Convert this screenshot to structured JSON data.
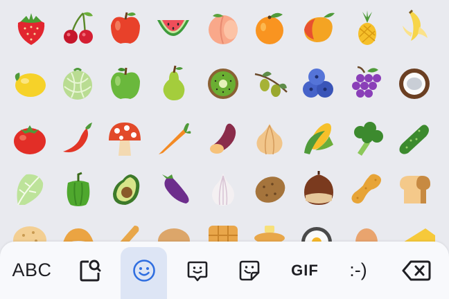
{
  "emoji_grid": {
    "rows": [
      [
        "strawberry-icon",
        "cherries-icon",
        "red-apple-icon",
        "watermelon-icon",
        "peach-icon",
        "tangerine-icon",
        "mango-icon",
        "pineapple-icon",
        "banana-icon"
      ],
      [
        "lemon-icon",
        "melon-icon",
        "green-apple-icon",
        "pear-icon",
        "kiwi-icon",
        "olive-icon",
        "blueberries-icon",
        "grapes-icon",
        "coconut-icon"
      ],
      [
        "tomato-icon",
        "hot-pepper-icon",
        "mushroom-icon",
        "carrot-icon",
        "sweet-potato-icon",
        "onion-icon",
        "corn-icon",
        "broccoli-icon",
        "cucumber-icon"
      ],
      [
        "leafy-green-icon",
        "bell-pepper-icon",
        "avocado-icon",
        "eggplant-icon",
        "garlic-icon",
        "potato-icon",
        "chestnut-icon",
        "peanuts-icon",
        "bread-icon"
      ],
      [
        "flatbread-icon",
        "croissant-icon",
        "baguette-icon",
        "bagel-icon",
        "waffle-icon",
        "pancakes-icon",
        "fried-egg-icon",
        "egg-icon",
        "cheese-icon"
      ]
    ]
  },
  "toolbar": {
    "abc_label": "ABC",
    "gif_label": "GIF",
    "emoticon_label": ":-)",
    "selected_tab": "emoji",
    "selected_color": "#2f6ee0",
    "selected_bg": "#dde5f5",
    "icons": [
      "emoji-search-icon",
      "smiley-face-icon",
      "emoji-kitchen-icon",
      "sticker-icon",
      "backspace-icon"
    ]
  }
}
